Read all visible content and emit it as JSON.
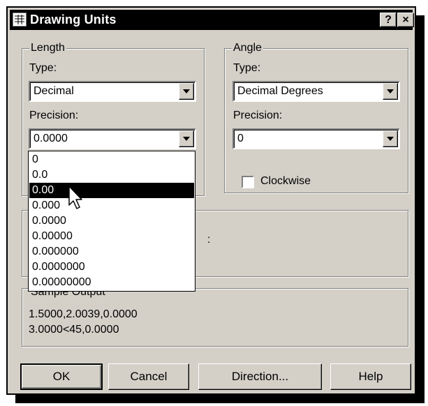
{
  "window": {
    "title": "Drawing Units",
    "help_label": "?",
    "close_label": "×"
  },
  "length": {
    "group_label": "Length",
    "type_label": "Type:",
    "type_value": "Decimal",
    "precision_label": "Precision:",
    "precision_value": "0.0000",
    "precision_options": [
      "0",
      "0.0",
      "0.00",
      "0.000",
      "0.0000",
      "0.00000",
      "0.000000",
      "0.0000000",
      "0.00000000"
    ],
    "highlighted_option": "0.00"
  },
  "angle": {
    "group_label": "Angle",
    "type_label": "Type:",
    "type_value": "Decimal Degrees",
    "precision_label": "Precision:",
    "precision_value": "0",
    "clockwise_label": "Clockwise",
    "clockwise_checked": false
  },
  "hidden_panel": {
    "visible_fragment": ":"
  },
  "sample_output": {
    "label": "Sample Output",
    "line1": "1.5000,2.0039,0.0000",
    "line2": "3.0000<45,0.0000"
  },
  "buttons": {
    "ok": "OK",
    "cancel": "Cancel",
    "direction": "Direction...",
    "help": "Help"
  },
  "icons": {
    "window_icon": "drawing-units-icon",
    "dropdown_arrow": "chevron-down-icon",
    "mouse_cursor": "mouse-pointer-icon"
  }
}
